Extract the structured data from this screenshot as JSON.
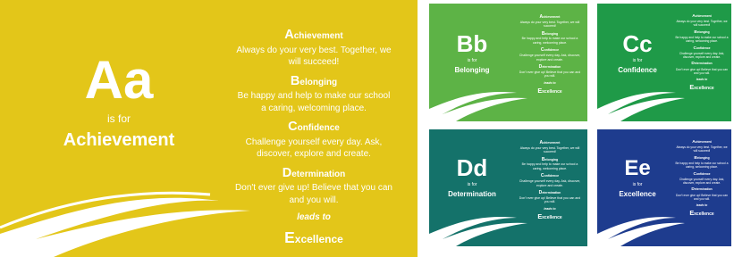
{
  "cards": [
    {
      "id": "aa",
      "letters": "Aa",
      "is_for": "is for",
      "word": "Achievement",
      "color": "#E3C619"
    },
    {
      "id": "bb",
      "letters": "Bb",
      "is_for": "is for",
      "word": "Belonging",
      "color": "#5DB346"
    },
    {
      "id": "cc",
      "letters": "Cc",
      "is_for": "is for",
      "word": "Confidence",
      "color": "#1F9A48"
    },
    {
      "id": "dd",
      "letters": "Dd",
      "is_for": "is for",
      "word": "Determination",
      "color": "#14726A"
    },
    {
      "id": "ee",
      "letters": "Ee",
      "is_for": "is for",
      "word": "Excellence",
      "color": "#1E3C8E"
    }
  ],
  "values": [
    {
      "cap": "A",
      "rest": "chievement",
      "text": "Always do your very best. Together, we will succeed!"
    },
    {
      "cap": "B",
      "rest": "elonging",
      "text": "Be happy and help to make our school a caring, welcoming place."
    },
    {
      "cap": "C",
      "rest": "onfidence",
      "text": "Challenge yourself every day. Ask, discover, explore and create."
    },
    {
      "cap": "D",
      "rest": "etermination",
      "text": "Don't ever give up! Believe that you can and you will."
    }
  ],
  "leads_to": "leads to",
  "excellence": {
    "cap": "E",
    "rest": "xcellence"
  }
}
